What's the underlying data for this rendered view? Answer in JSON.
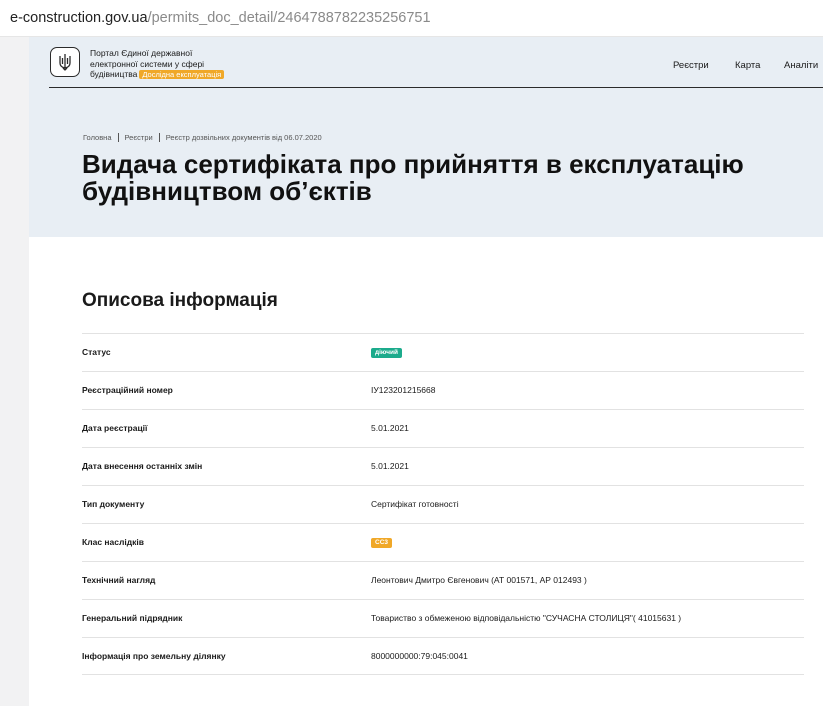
{
  "browser": {
    "url_domain": "e-construction.gov.ua",
    "url_path": "/permits_doc_detail/2464788782235256751"
  },
  "header": {
    "portal_line1": "Портал Єдиної державної",
    "portal_line2": "електронної системи у сфері",
    "portal_line3": "будівництва",
    "beta_label": "Дослідна експлуатація",
    "nav": [
      "Реєстри",
      "Карта",
      "Аналіти"
    ]
  },
  "breadcrumb": [
    "Головна",
    "Реєстри",
    "Реєстр дозвільних документів від 06.07.2020"
  ],
  "page_title_line1": "Видача сертифіката про прийняття в експлуатацію",
  "page_title_line2": "будівництвом об’єктів",
  "section_title": "Описова інформація",
  "info": [
    {
      "label": "Статус",
      "value": "діючий",
      "badge": "green"
    },
    {
      "label": "Реєстраційний номер",
      "value": "ІУ123201215668"
    },
    {
      "label": "Дата реєстрації",
      "value": "5.01.2021"
    },
    {
      "label": "Дата внесення останніх змін",
      "value": "5.01.2021"
    },
    {
      "label": "Тип документу",
      "value": "Сертифікат готовності"
    },
    {
      "label": "Клас наслідків",
      "value": "СС3",
      "badge": "orange"
    },
    {
      "label": "Технічний нагляд",
      "value": "Леонтович Дмитро Євгенович (АТ 001571, АР 012493 )"
    },
    {
      "label": "Генеральний підрядник",
      "value": "Товариство з обмеженою відповідальністю \"СУЧАСНА СТОЛИЦЯ\"( 41015631 )"
    },
    {
      "label": "Інформація про земельну ділянку",
      "value": "8000000000:79:045:0041"
    }
  ],
  "colors": {
    "header_bg": "#e8eef4",
    "status_active": "#1cab8c",
    "class_badge": "#f0a828"
  }
}
